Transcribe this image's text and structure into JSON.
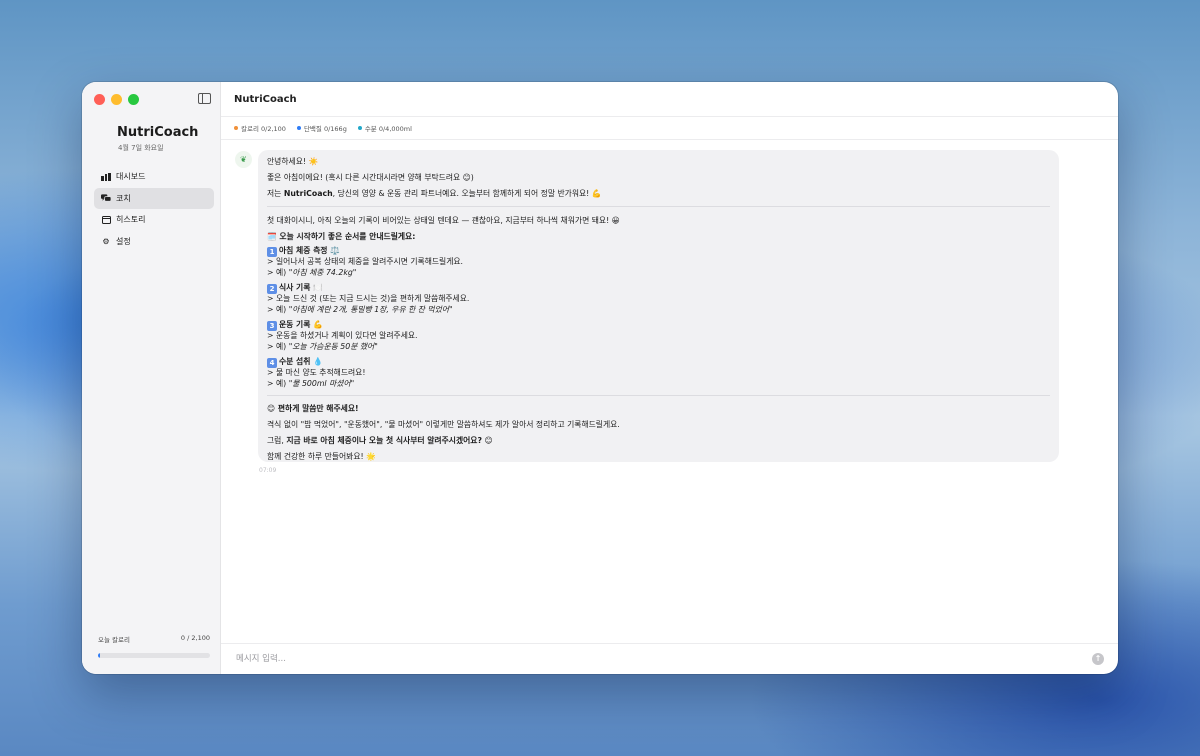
{
  "sidebar": {
    "title": "NutriCoach",
    "date": "4월 7일 화요일",
    "nav": [
      {
        "label": "대시보드",
        "icon": "bar-chart-icon",
        "active": false
      },
      {
        "label": "코치",
        "icon": "chat-bubbles-icon",
        "active": true
      },
      {
        "label": "히스토리",
        "icon": "calendar-icon",
        "active": false
      },
      {
        "label": "설정",
        "icon": "gear-icon",
        "active": false
      }
    ],
    "footer": {
      "label": "오늘 칼로리",
      "value": "0 / 2,100",
      "progress_fraction": 0.01
    }
  },
  "header": {
    "title": "NutriCoach"
  },
  "stats": [
    {
      "label": "칼로리 0/2,100",
      "color": "#f0913a"
    },
    {
      "label": "단백질 0/166g",
      "color": "#2f7cf6"
    },
    {
      "label": "수분 0/4,000ml",
      "color": "#22a8c9"
    }
  ],
  "message": {
    "avatar_icon": "leaf-icon",
    "greeting": "안녕하세요! ☀️",
    "intro_1": "좋은 아침이에요! (혹시 다른 시간대시라면 양해 부탁드려요 😊)",
    "intro_2_prefix": "저는 ",
    "intro_2_bold": "NutriCoach",
    "intro_2_suffix": ", 당신의 영양 & 운동 관리 파트너예요. 오늘부터 함께하게 되어 정말 반가워요! 💪",
    "empty_note": "첫 대화이시니, 아직 오늘의 기록이 비어있는 상태일 텐데요 — 괜찮아요, 지금부터 하나씩 채워가면 돼요! 😀",
    "steps_heading": "🗓️ 오늘 시작하기 좋은 순서를 안내드릴게요:",
    "steps": [
      {
        "num": "1",
        "title": "아침 체중 측정 ⚖️",
        "desc": "> 일어나서 공복 상태의 체중을 알려주시면 기록해드릴게요.",
        "example_prefix": "> 예) ",
        "example": "\"아침 체중 74.2kg\""
      },
      {
        "num": "2",
        "title": "식사 기록 🍽️",
        "desc": "> 오늘 드신 것 (또는 지금 드시는 것)을 편하게 말씀해주세요.",
        "example_prefix": "> 예) ",
        "example": "\"아침에 계란 2개, 통밀빵 1장, 우유 한 잔 먹었어\""
      },
      {
        "num": "3",
        "title": "운동 기록 💪",
        "desc": "> 운동을 하셨거나 계획이 있다면 알려주세요.",
        "example_prefix": "> 예) ",
        "example": "\"오늘 가슴운동 50분 했어\""
      },
      {
        "num": "4",
        "title": "수분 섭취 💧",
        "desc": "> 물 마신 양도 추적해드려요!",
        "example_prefix": "> 예) ",
        "example": "\"물 500ml 마셨어\""
      }
    ],
    "tip_heading": "😊 편하게 말씀만 해주세요!",
    "tip_body": "격식 없이 \"밥 먹었어\", \"운동했어\", \"물 마셨어\" 이렇게만 말씀하셔도 제가 알아서 정리하고 기록해드릴게요.",
    "cta_prefix": "그럼, ",
    "cta_bold": "지금 바로 아침 체중이나 오늘 첫 식사부터 알려주시겠어요?",
    "cta_suffix": " 😊",
    "closing": "함께 건강한 하루 만들어봐요! 🌟",
    "timestamp": "07:09"
  },
  "composer": {
    "placeholder": "메시지 입력...",
    "send_icon": "send-arrow-icon"
  }
}
